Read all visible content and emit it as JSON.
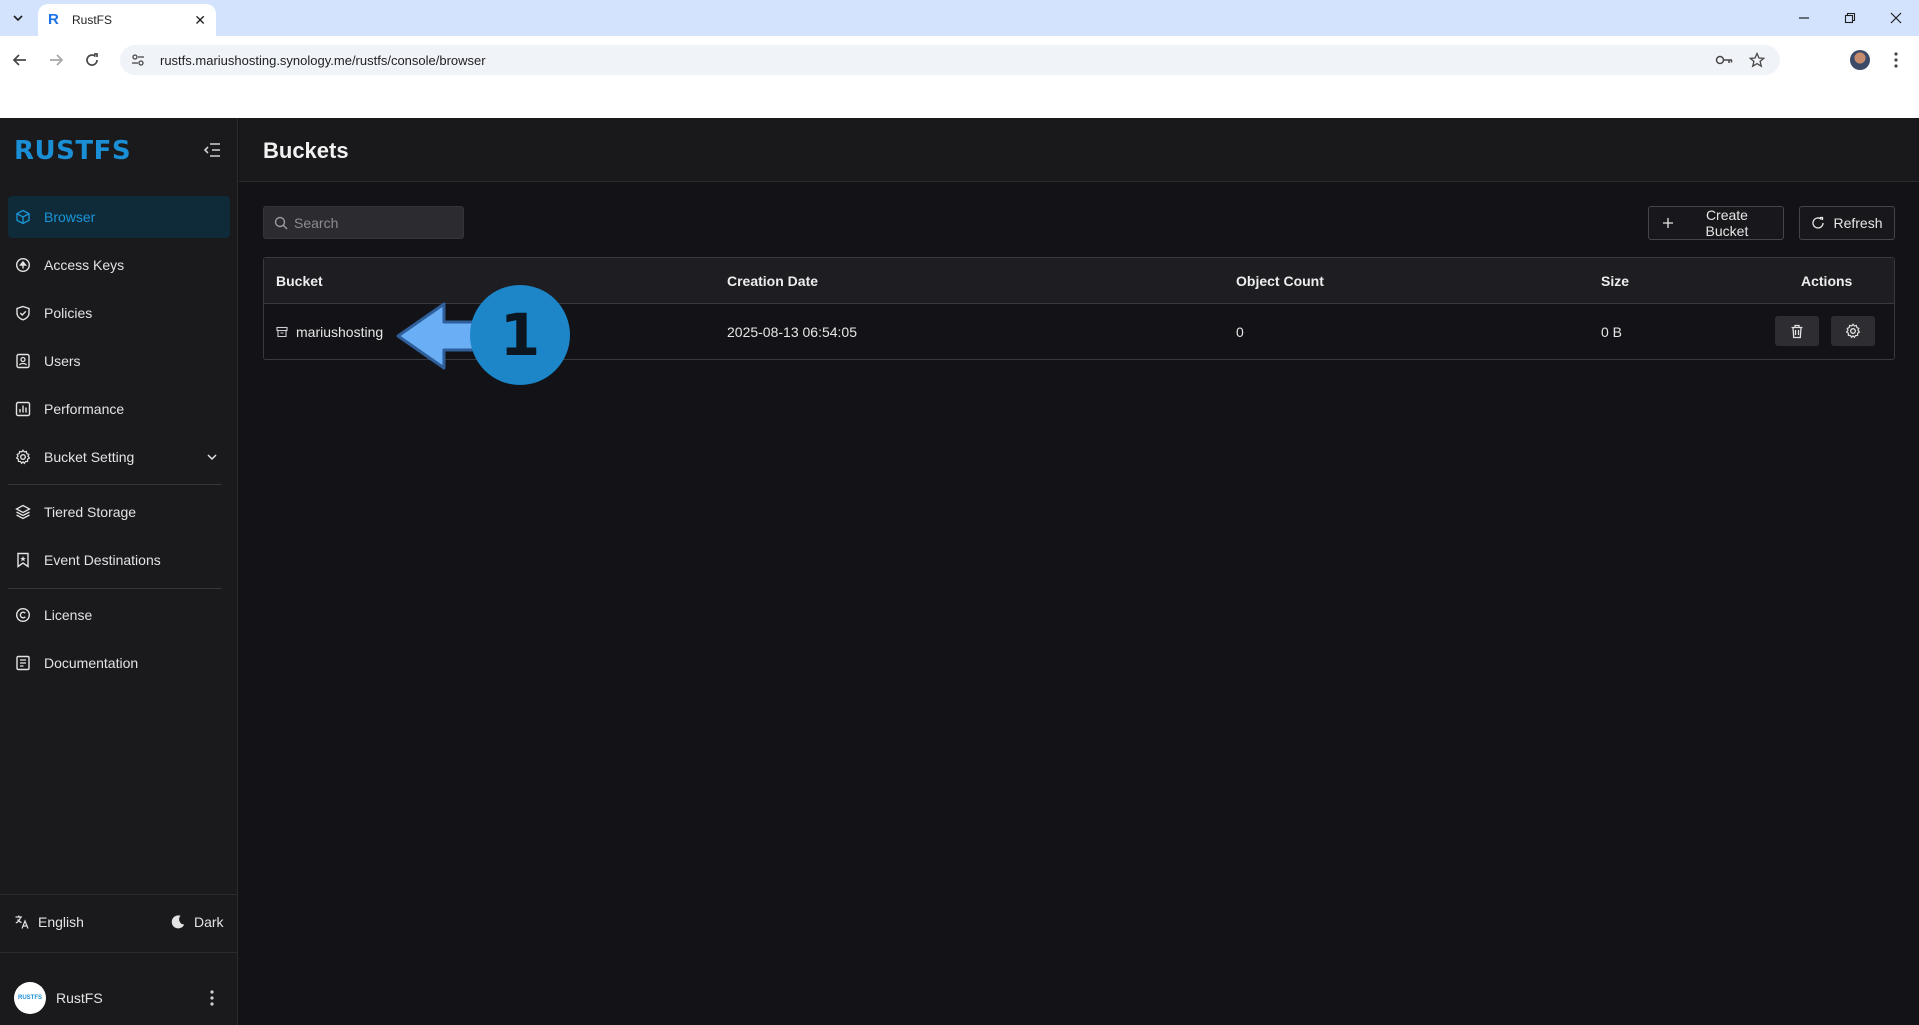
{
  "browser": {
    "tab_title": "RustFS",
    "favicon_letter": "R",
    "url": "rustfs.mariushosting.synology.me/rustfs/console/browser"
  },
  "app": {
    "logo": "RUSTFS",
    "page_title": "Buckets",
    "accent_color": "#1a8fd6"
  },
  "sidebar": {
    "items": [
      {
        "label": "Browser",
        "icon": "cube-icon",
        "active": true
      },
      {
        "label": "Access Keys",
        "icon": "key-circle-icon"
      },
      {
        "label": "Policies",
        "icon": "shield-check-icon"
      },
      {
        "label": "Users",
        "icon": "user-badge-icon"
      },
      {
        "label": "Performance",
        "icon": "bar-chart-icon"
      },
      {
        "label": "Bucket Setting",
        "icon": "gear-icon",
        "expandable": true
      },
      {
        "label": "Tiered Storage",
        "icon": "layers-icon"
      },
      {
        "label": "Event Destinations",
        "icon": "bookmark-star-icon"
      },
      {
        "label": "License",
        "icon": "copyright-icon"
      },
      {
        "label": "Documentation",
        "icon": "document-icon"
      }
    ],
    "language": "English",
    "theme": "Dark",
    "user": "RustFS",
    "user_avatar_text": "RUSTFS"
  },
  "toolbar": {
    "search_placeholder": "Search",
    "create_label": "Create Bucket",
    "refresh_label": "Refresh"
  },
  "table": {
    "headers": [
      "Bucket",
      "Creation Date",
      "Object Count",
      "Size",
      "Actions"
    ],
    "rows": [
      {
        "bucket": "mariushosting",
        "created": "2025-08-13 06:54:05",
        "objects": "0",
        "size": "0 B"
      }
    ]
  },
  "annotation": {
    "step": "1",
    "color": "#1c86c8"
  }
}
